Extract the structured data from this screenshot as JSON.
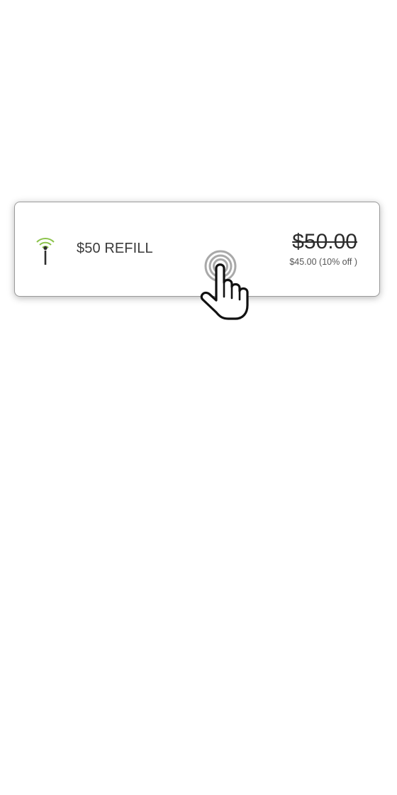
{
  "refill_option": {
    "label": "$50 REFILL",
    "original_price": "$50.00",
    "discount_line": "$45.00 (10% off )",
    "signal_icon": "signal-tower-icon",
    "signal_color": "#8bc34a"
  },
  "overlay": {
    "cursor_icon": "tap-hand-cursor-icon"
  }
}
